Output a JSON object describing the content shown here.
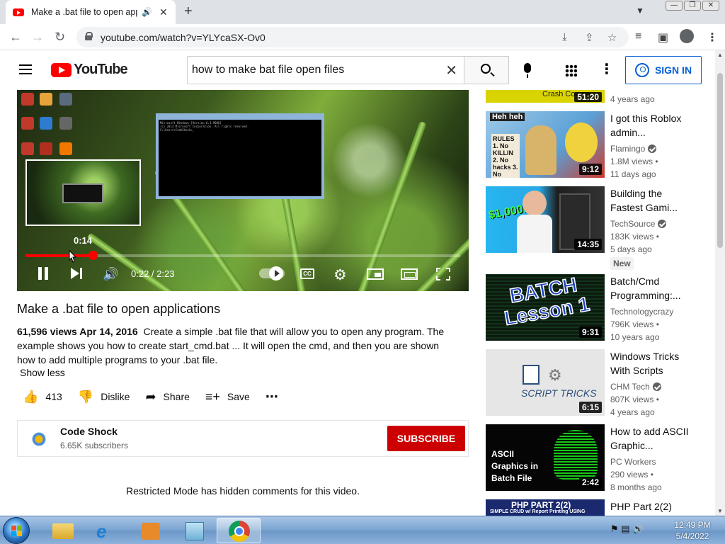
{
  "browser": {
    "tab_title": "Make a .bat file to open applications - YouTube",
    "tab_close": "✕",
    "new_tab": "+",
    "url": "youtube.com/watch?v=YLYcaSX-Ov0",
    "window_controls": [
      "—",
      "❐",
      "✕"
    ]
  },
  "header": {
    "logo_text": "YouTube",
    "search_query": "how to make bat file open files",
    "sign_in": "SIGN IN"
  },
  "player": {
    "preview_time": "0:14",
    "current_time": "0:22 / 2:23",
    "progress_fraction": 0.154,
    "cmd_lines": [
      "Microsoft Windows [Version 6.3.9600]",
      "(c) 2013 Microsoft Corporation. All rights reserved.",
      "",
      "C:\\Users\\CodeShock>_"
    ]
  },
  "video": {
    "title": "Make a .bat file to open applications",
    "views_date": "61,596 views  Apr 14, 2016",
    "description": "Create a simple .bat file that will allow you to open any program. The example shows you how to create start_cmd.bat ... It will open the cmd, and then you are shown how to add multiple programs to your .bat file.",
    "show_less": "Show less",
    "likes": "413",
    "dislike": "Dislike",
    "share": "Share",
    "save": "Save"
  },
  "channel": {
    "name": "Code Shock",
    "subscribers": "6.65K subscribers",
    "subscribe": "SUBSCRIBE"
  },
  "comments_notice": "Restricted Mode has hidden comments for this video.",
  "recommendations": [
    {
      "title": "",
      "channel": "",
      "views": "",
      "age": "4 years ago",
      "duration": "51:20",
      "thumb_text": "Crash Course"
    },
    {
      "title": "I got this Roblox admin...",
      "channel": "Flamingo",
      "views": "1.8M views •",
      "age": "11 days ago",
      "duration": "9:12",
      "thumb_text": "RULES 1. No KILLIN 2. No hacks 3. No",
      "thumb_text2": "Heh heh"
    },
    {
      "title": "Building the Fastest Gami...",
      "channel": "TechSource",
      "views": "183K views •",
      "age": "5 days ago",
      "duration": "14:35",
      "badge": "New",
      "thumb_text": "$1,000!"
    },
    {
      "title": "Batch/Cmd Programming:...",
      "channel": "Technologycrazy",
      "views": "796K views •",
      "age": "10 years ago",
      "duration": "9:31",
      "thumb_text": "BATCH Lesson 1"
    },
    {
      "title": "Windows Tricks With Scripts",
      "channel": "CHM Tech",
      "views": "807K views •",
      "age": "4 years ago",
      "duration": "6:15",
      "thumb_text": "SCRIPT TRICKS"
    },
    {
      "title": "How to add ASCII Graphic...",
      "channel": "PC Workers",
      "views": "290 views •",
      "age": "8 months ago",
      "duration": "2:42",
      "thumb_text": "ASCII Graphics in Batch File"
    },
    {
      "title": "PHP Part 2(2)",
      "thumb_text": "PHP PART 2(2)",
      "thumb_sub": "SIMPLE CRUD w/ Report Printing USING"
    }
  ],
  "taskbar": {
    "time": "12:49 PM",
    "date": "5/4/2022"
  },
  "colors": {
    "yt_red": "#ff0000",
    "link_blue": "#065fd4",
    "subscribe_red": "#cc0000"
  }
}
